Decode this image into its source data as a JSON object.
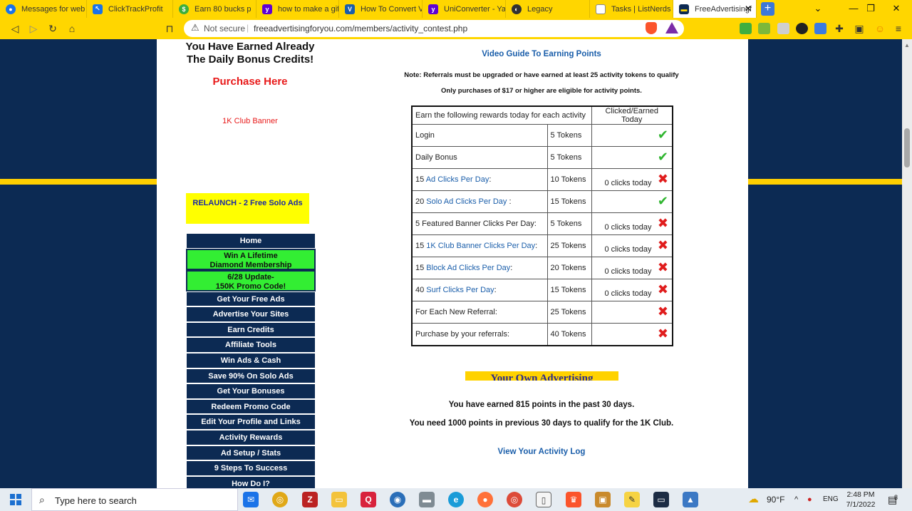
{
  "browser": {
    "tabs": [
      {
        "label": "Messages for web",
        "icon": "messages-icon",
        "color": "#1a73e8"
      },
      {
        "label": "ClickTrackProfit",
        "icon": "clicktrackprofit-icon",
        "color": "#1a73e8"
      },
      {
        "label": "Earn 80 bucks p",
        "icon": "earn-icon",
        "color": "#3cae3c"
      },
      {
        "label": "how to make a gif",
        "icon": "yahoo-icon",
        "color": "#6001d2"
      },
      {
        "label": "How To Convert Vid",
        "icon": "v-icon",
        "color": "#1a5eaa"
      },
      {
        "label": "UniConverter - Yah",
        "icon": "yahoo-icon",
        "color": "#6001d2"
      },
      {
        "label": "Legacy",
        "icon": "legacy-icon",
        "color": "#333333"
      },
      {
        "label": "Tasks | ListNerds",
        "icon": "listnerds-icon",
        "color": "#ffffff"
      },
      {
        "label": "FreeAdvertisingf",
        "icon": "freeadvertising-icon",
        "color": "#0c2a53"
      }
    ],
    "url_security": "Not secure",
    "url": "freeadvertisingforyou.com/members/activity_contest.php",
    "new_tab": "+",
    "win_min": "—",
    "win_max": "❐",
    "win_close": "✕",
    "chevron": "⌄"
  },
  "sidebar": {
    "earned_line1": "You Have Earned Already",
    "earned_line2": "The Daily Bonus Credits!",
    "purchase": "Purchase Here",
    "banner": "1K Club Banner",
    "relaunch": "RELAUNCH - 2 Free Solo Ads",
    "nav": [
      {
        "label": "Home",
        "style": "blue"
      },
      {
        "label": "Win A Lifetime",
        "label2": "Diamond Membership",
        "style": "green"
      },
      {
        "label": "6/28 Update-",
        "label2": "150K Promo Code!",
        "style": "green"
      },
      {
        "label": "Get Your Free Ads",
        "style": "blue"
      },
      {
        "label": "Advertise Your Sites",
        "style": "blue"
      },
      {
        "label": "Earn Credits",
        "style": "blue"
      },
      {
        "label": "Affiliate Tools",
        "style": "blue"
      },
      {
        "label": "Win Ads & Cash",
        "style": "blue"
      },
      {
        "label": "Save 90% On Solo Ads",
        "style": "blue"
      },
      {
        "label": "Get Your Bonuses",
        "style": "blue"
      },
      {
        "label": "Redeem Promo Code",
        "style": "blue"
      },
      {
        "label": "Edit Your Profile and Links",
        "style": "blue"
      },
      {
        "label": "Activity Rewards",
        "style": "blue"
      },
      {
        "label": "Ad Setup / Stats",
        "style": "blue"
      },
      {
        "label": "9 Steps To Success",
        "style": "blue"
      },
      {
        "label": "How Do I?",
        "style": "blue"
      }
    ]
  },
  "main": {
    "video_guide": "Video Guide To Earning Points",
    "note": "Note: Referrals must be upgraded or have earned at least 25 activity tokens to qualify",
    "only_purchases": "Only purchases of $17 or higher are eligible for activity points.",
    "table": {
      "header": [
        "Earn the following rewards today for each activity",
        "Clicked/Earned Today"
      ],
      "rows": [
        {
          "pre": "Login",
          "link": "",
          "post": "",
          "tokens": "5 Tokens",
          "count": "",
          "status": "done"
        },
        {
          "pre": "Daily Bonus",
          "link": "",
          "post": "",
          "tokens": "5 Tokens",
          "count": "",
          "status": "done"
        },
        {
          "pre": "15 ",
          "link": "Ad Clicks Per Day",
          "post": ":",
          "tokens": "10 Tokens",
          "count": "0 clicks today",
          "status": "not-done"
        },
        {
          "pre": "20 ",
          "link": "Solo Ad Clicks Per Day",
          "post": " :",
          "tokens": "15 Tokens",
          "count": "",
          "status": "done"
        },
        {
          "pre": "5 Featured Banner Clicks Per Day:",
          "link": "",
          "post": "",
          "tokens": "5 Tokens",
          "count": "0 clicks today",
          "status": "not-done"
        },
        {
          "pre": "15 ",
          "link": "1K Club Banner Clicks Per Day",
          "post": ":",
          "tokens": "25 Tokens",
          "count": "0 clicks today",
          "status": "not-done"
        },
        {
          "pre": "15 ",
          "link": "Block Ad Clicks Per Day",
          "post": ":",
          "tokens": "20 Tokens",
          "count": "0 clicks today",
          "status": "not-done"
        },
        {
          "pre": "40 ",
          "link": "Surf Clicks Per Day",
          "post": ":",
          "tokens": "15 Tokens",
          "count": "0 clicks today",
          "status": "not-done"
        },
        {
          "pre": "For Each New Referral:",
          "link": "",
          "post": "",
          "tokens": "25 Tokens",
          "count": "",
          "status": "not-done"
        },
        {
          "pre": "Purchase by your referrals:",
          "link": "",
          "post": "",
          "tokens": "40 Tokens",
          "count": "",
          "status": "not-done"
        }
      ]
    },
    "own_advertising": "Your Own Advertising",
    "points_earned": "You have earned 815 points in the past 30 days.",
    "points_needed": "You need 1000 points in previous 30 days to qualify for the 1K Club.",
    "activity_log": "View Your Activity Log"
  },
  "taskbar": {
    "search_placeholder": "Type here to search",
    "weather": "90°F",
    "lang": "ENG",
    "time": "2:48 PM",
    "date": "7/1/2022",
    "notifications": "8"
  }
}
